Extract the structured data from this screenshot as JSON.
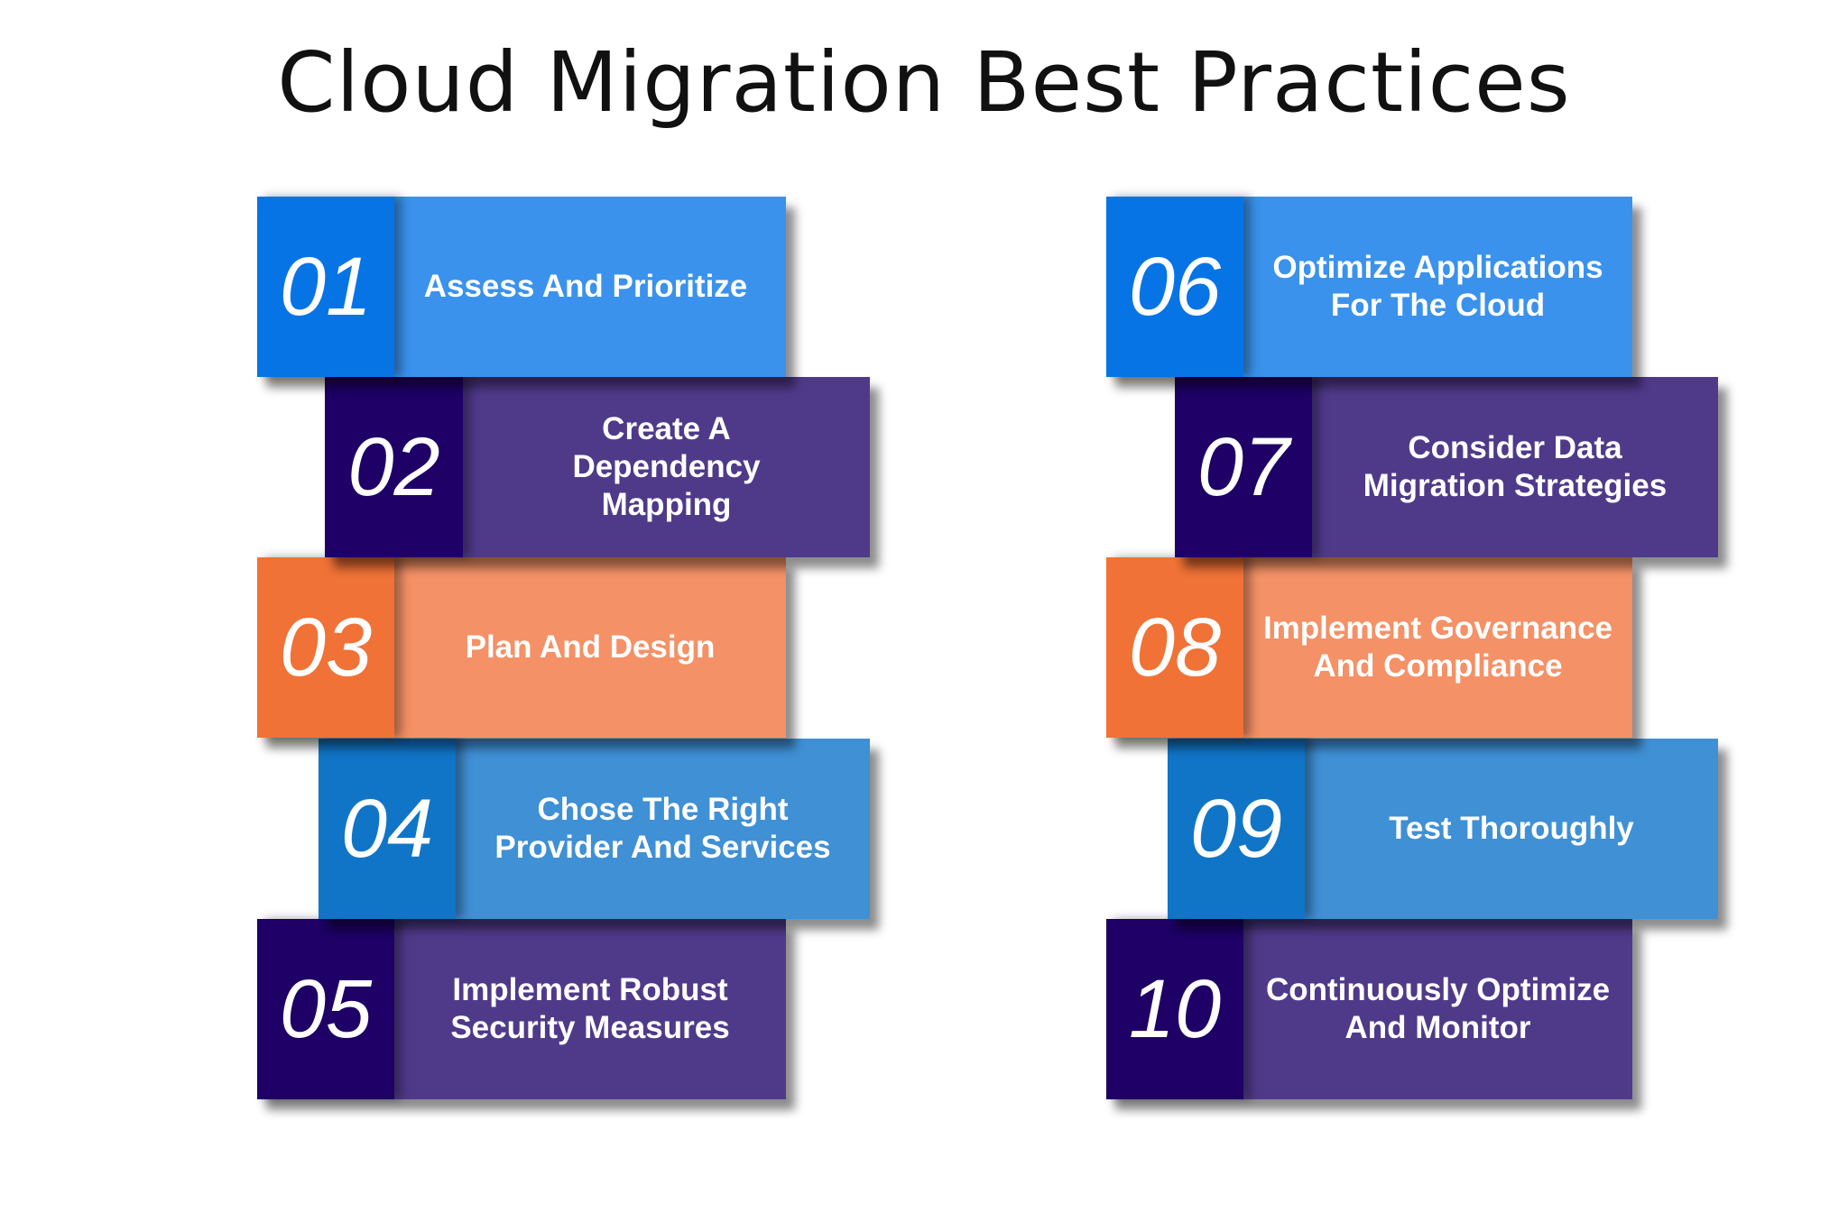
{
  "title": "Cloud Migration Best Practices",
  "items": [
    {
      "number": "01",
      "label": "Assess And Prioritize",
      "color": "blue"
    },
    {
      "number": "02",
      "label": "Create A Dependency Mapping",
      "color": "purple"
    },
    {
      "number": "03",
      "label": "Plan And Design",
      "color": "orange"
    },
    {
      "number": "04",
      "label": "Chose The Right Provider And Services",
      "color": "light-blue"
    },
    {
      "number": "05",
      "label": "Implement Robust Security Measures",
      "color": "purple"
    },
    {
      "number": "06",
      "label": "Optimize Applications For The Cloud",
      "color": "blue"
    },
    {
      "number": "07",
      "label": "Consider Data Migration Strategies",
      "color": "purple"
    },
    {
      "number": "08",
      "label": "Implement Governance And Compliance",
      "color": "orange"
    },
    {
      "number": "09",
      "label": "Test Thoroughly",
      "color": "light-blue"
    },
    {
      "number": "10",
      "label": "Continuously Optimize And Monitor",
      "color": "purple"
    }
  ],
  "colors": {
    "blue": {
      "number_bg": "#0774e6",
      "label_bg": "#3a92ec"
    },
    "purple": {
      "number_bg": "#1e0066",
      "label_bg": "#4f3a8a"
    },
    "orange": {
      "number_bg": "#f07236",
      "label_bg": "#f49166"
    },
    "light-blue": {
      "number_bg": "#1175c7",
      "label_bg": "#3f90d5"
    }
  }
}
